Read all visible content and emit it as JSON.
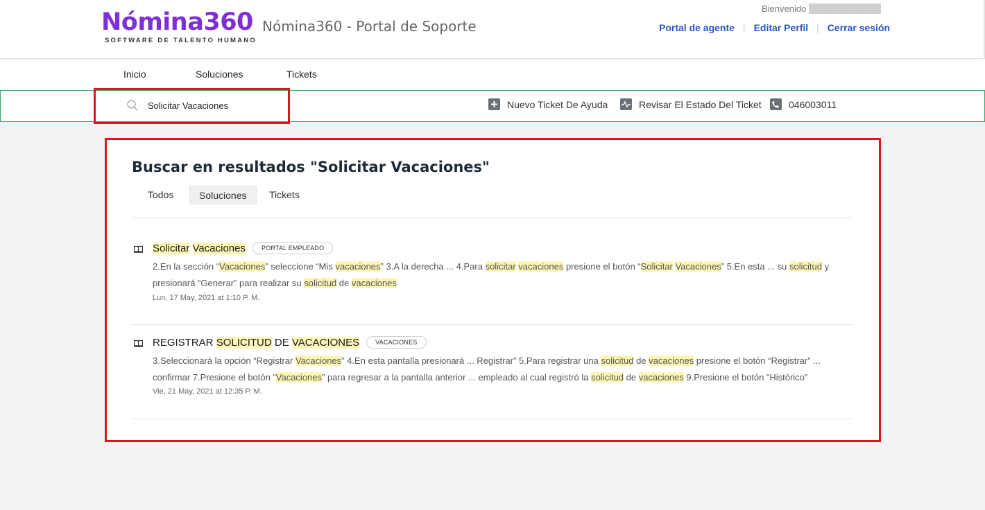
{
  "header": {
    "logo_main": "Nómina360",
    "logo_sub": "SOFTWARE DE TALENTO HUMANO",
    "portal_title": "Nómina360 - Portal de Soporte",
    "welcome": "Bienvenido",
    "links": [
      "Portal de agente",
      "Editar Perfil",
      "Cerrar sesión"
    ]
  },
  "nav": {
    "items": [
      "Inicio",
      "Soluciones",
      "Tickets"
    ]
  },
  "search": {
    "value": "Solicitar Vacaciones"
  },
  "actions": {
    "new_ticket": "Nuevo Ticket De Ayuda",
    "check_status": "Revisar El Estado Del Ticket",
    "phone": "046003011"
  },
  "results": {
    "title": "Buscar en resultados \"Solicitar Vacaciones\"",
    "tabs": [
      "Todos",
      "Soluciones",
      "Tickets"
    ],
    "active_tab": "Soluciones",
    "items": [
      {
        "title": "Solicitar Vacaciones",
        "badge": "PORTAL EMPLEADO",
        "desc": "2.En la sección “Vacaciones” seleccione “Mis vacaciones”   3.A la derecha ...   4.Para solicitar vacaciones presione el botón “Solicitar Vacaciones”  5.En esta ... su solicitud y presionará “Generar” para realizar su solicitud de vacaciones",
        "date": "Lun, 17 May, 2021 at 1:10 P. M."
      },
      {
        "title": "REGISTRAR SOLICITUD DE VACACIONES",
        "badge": "VACACIONES",
        "desc": "3.Seleccionará la opción “Registrar Vacaciones”    4.En esta pantalla presionará ... Registrar” 5.Para registrar una solicitud de vacaciones presione el botón “Registrar” ... confirmar 7.Presione el botón “Vacaciones” para regresar a la pantalla anterior ... empleado al cual registró la solicitud de vacaciones 9.Presione el botón “Histórico”",
        "date": "Vie, 21 May, 2021 at 12:35 P. M."
      }
    ]
  },
  "colors": {
    "brand": "#7f2fd6",
    "link": "#2855c6",
    "highlight": "#fcf6b4",
    "annotation": "#e0141e",
    "search_border": "#3aa56c"
  },
  "icons": [
    "search-icon",
    "plus-icon",
    "activity-icon",
    "phone-icon",
    "book-icon"
  ]
}
